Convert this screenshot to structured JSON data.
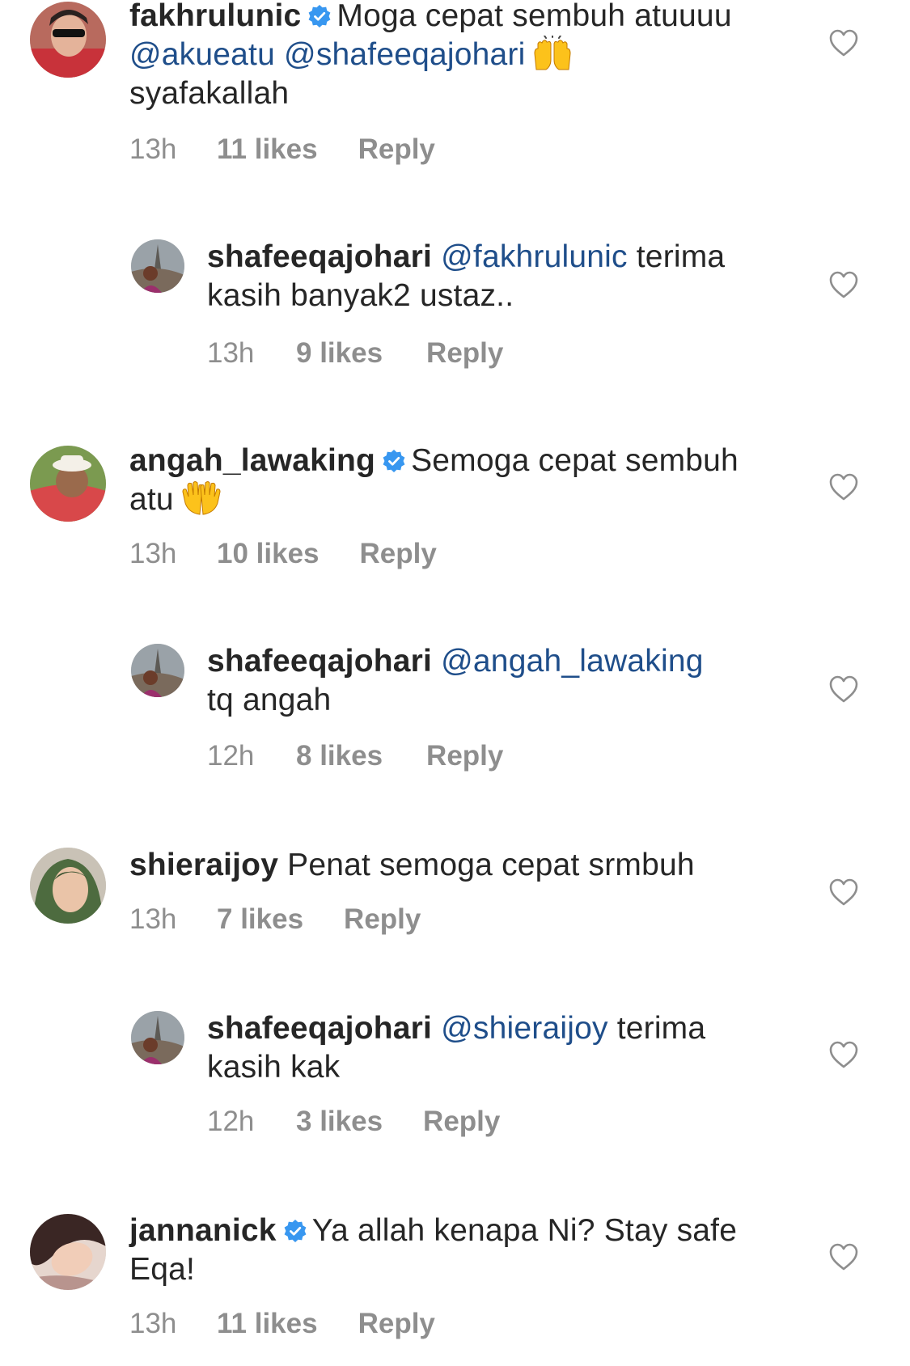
{
  "comments": [
    {
      "username": "fakhrulunic",
      "verified": true,
      "text": "Moga cepat sembuh atuuuu",
      "mentions": [
        "@akueatu",
        "@shafeeqajohari"
      ],
      "emoji": "raised-hands-icon",
      "text_after": "syafakallah",
      "time": "13h",
      "likes": "11 likes",
      "reply_label": "Reply"
    },
    {
      "username": "shafeeqajohari",
      "mention": "@fakhrulunic",
      "text": "terima kasih banyak2 ustaz..",
      "time": "13h",
      "likes": "9 likes",
      "reply_label": "Reply"
    },
    {
      "username": "angah_lawaking",
      "verified": true,
      "text": "Semoga cepat sembuh atu",
      "emoji": "open-hands-icon",
      "time": "13h",
      "likes": "10 likes",
      "reply_label": "Reply"
    },
    {
      "username": "shafeeqajohari",
      "mention": "@angah_lawaking",
      "text": "tq angah",
      "time": "12h",
      "likes": "8 likes",
      "reply_label": "Reply"
    },
    {
      "username": "shieraijoy",
      "text": "Penat semoga cepat srmbuh",
      "time": "13h",
      "likes": "7 likes",
      "reply_label": "Reply"
    },
    {
      "username": "shafeeqajohari",
      "mention": "@shieraijoy",
      "text": "terima kasih kak",
      "time": "12h",
      "likes": "3 likes",
      "reply_label": "Reply"
    },
    {
      "username": "jannanick",
      "verified": true,
      "text": "Ya allah kenapa Ni? Stay safe Eqa!",
      "time": "13h",
      "likes": "11 likes",
      "reply_label": "Reply"
    }
  ],
  "colors": {
    "text": "#262626",
    "mention": "#1f4e8a",
    "meta": "#8e8e8e",
    "verified": "#3897f0"
  }
}
